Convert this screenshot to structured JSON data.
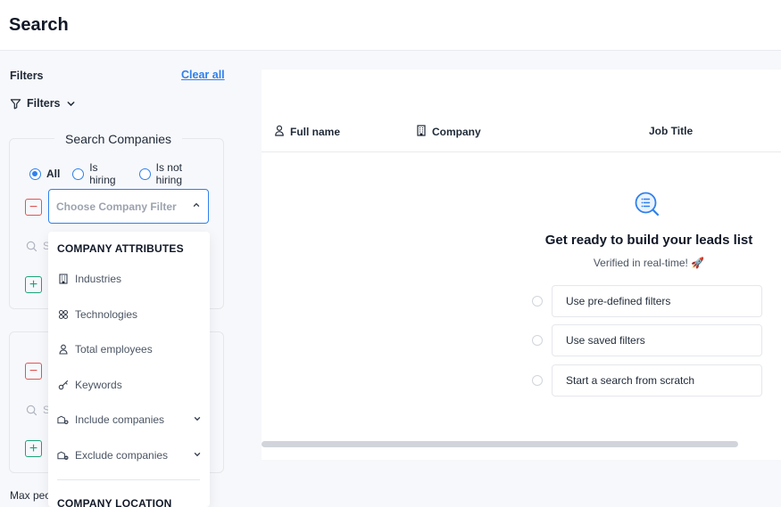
{
  "header": {
    "title": "Search"
  },
  "sidebar": {
    "filters_title": "Filters",
    "clear_all": "Clear all",
    "filters_toggle": "Filters",
    "company_card": {
      "legend": "Search Companies",
      "radio_options": [
        {
          "label": "All",
          "selected": true
        },
        {
          "label": "Is hiring",
          "selected": false
        },
        {
          "label": "Is not hiring",
          "selected": false
        }
      ],
      "select_placeholder": "Choose Company Filter",
      "search_stub": "S"
    },
    "second_card": {
      "search_stub": "S"
    },
    "max_people_label": "Max peo"
  },
  "dropdown": {
    "section_attributes": "COMPANY ATTRIBUTES",
    "items": [
      {
        "label": "Industries",
        "icon": "building-icon"
      },
      {
        "label": "Technologies",
        "icon": "technologies-icon"
      },
      {
        "label": "Total employees",
        "icon": "person-icon"
      },
      {
        "label": "Keywords",
        "icon": "key-icon"
      },
      {
        "label": "Include companies",
        "icon": "company-add-icon",
        "expandable": true
      },
      {
        "label": "Exclude companies",
        "icon": "company-remove-icon",
        "expandable": true
      }
    ],
    "section_location": "COMPANY LOCATION"
  },
  "table": {
    "columns": [
      {
        "label": "Full name",
        "icon": "person-icon"
      },
      {
        "label": "Company",
        "icon": "building-icon"
      },
      {
        "label": "Job Title",
        "icon": ""
      }
    ]
  },
  "empty_state": {
    "icon": "search-list-icon",
    "title": "Get ready to build your leads list",
    "subtitle": "Verified in real-time! 🚀",
    "options": [
      {
        "label": "Use pre-defined filters"
      },
      {
        "label": "Use saved filters"
      },
      {
        "label": "Start a search from scratch"
      }
    ]
  },
  "colors": {
    "accent": "#2f80ed",
    "minus": "#e05555",
    "plus": "#1aa37a",
    "panel_bg": "#f7f8fb"
  }
}
